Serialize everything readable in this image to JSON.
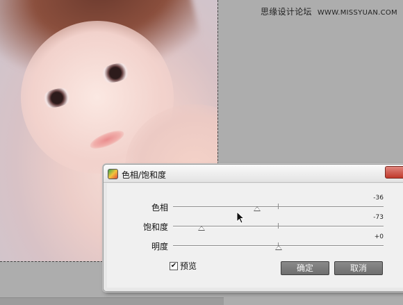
{
  "watermark": {
    "site_name": "思缘设计论坛",
    "url": "WWW.MISSYUAN.COM"
  },
  "dialog": {
    "title": "色相/饱和度",
    "sliders": [
      {
        "label": "色相",
        "value_text": "-36",
        "value": -36,
        "min": -180,
        "max": 180
      },
      {
        "label": "饱和度",
        "value_text": "-73",
        "value": -73,
        "min": -100,
        "max": 100
      },
      {
        "label": "明度",
        "value_text": "+0",
        "value": 0,
        "min": -100,
        "max": 100
      }
    ],
    "preview_label": "预览",
    "preview_checked": true,
    "ok_label": "确定",
    "cancel_label": "取消"
  },
  "icons": {
    "dialog_icon": "photoshop-app-icon",
    "cursor": "mouse-pointer-icon",
    "close": "close-icon"
  }
}
